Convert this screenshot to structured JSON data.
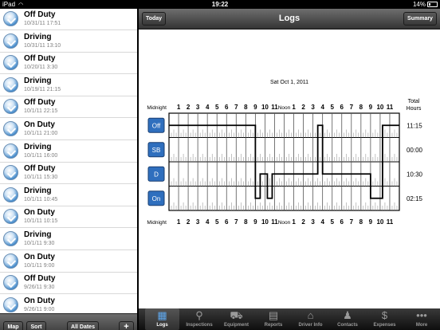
{
  "status_bar": {
    "carrier": "iPad",
    "time": "19:22",
    "battery": "14%"
  },
  "entries": [
    {
      "status": "Off Duty",
      "time": "10/31/11 17:51"
    },
    {
      "status": "Driving",
      "time": "10/31/11 13:10"
    },
    {
      "status": "Off Duty",
      "time": "10/20/11 3:30"
    },
    {
      "status": "Driving",
      "time": "10/19/11 21:15"
    },
    {
      "status": "Off Duty",
      "time": "10/1/11 22:15"
    },
    {
      "status": "On Duty",
      "time": "10/1/11 21:00"
    },
    {
      "status": "Driving",
      "time": "10/1/11 16:00"
    },
    {
      "status": "Off Duty",
      "time": "10/1/11 15:30"
    },
    {
      "status": "Driving",
      "time": "10/1/11 10:45"
    },
    {
      "status": "On Duty",
      "time": "10/1/11 10:15"
    },
    {
      "status": "Driving",
      "time": "10/1/11 9:30"
    },
    {
      "status": "On Duty",
      "time": "10/1/11 9:00"
    },
    {
      "status": "Off Duty",
      "time": "9/26/11 9:30"
    },
    {
      "status": "On Duty",
      "time": "9/26/11 9:00"
    }
  ],
  "left_toolbar": {
    "map": "Map",
    "sort": "Sort",
    "all_dates": "All Dates",
    "add": "+"
  },
  "nav": {
    "today": "Today",
    "title": "Logs",
    "summary": "Summary"
  },
  "log": {
    "date": "Sat Oct 1, 2011",
    "top_labels": [
      "Midnight",
      "1",
      "2",
      "3",
      "4",
      "5",
      "6",
      "7",
      "8",
      "9",
      "10",
      "11",
      "Noon",
      "1",
      "2",
      "3",
      "4",
      "5",
      "6",
      "7",
      "8",
      "9",
      "10",
      "11"
    ],
    "bottom_labels": [
      "Midnight",
      "1",
      "2",
      "3",
      "4",
      "5",
      "6",
      "7",
      "8",
      "9",
      "10",
      "11",
      "Noon",
      "1",
      "2",
      "3",
      "4",
      "5",
      "6",
      "7",
      "8",
      "9",
      "10",
      "11"
    ],
    "total_header": "Total Hours",
    "rows": [
      {
        "label": "Off",
        "total": "11:15"
      },
      {
        "label": "SB",
        "total": "00:00"
      },
      {
        "label": "D",
        "total": "10:30"
      },
      {
        "label": "On",
        "total": "02:15"
      }
    ],
    "segments": [
      {
        "start": 0,
        "end": 9,
        "row": 0
      },
      {
        "start": 9,
        "end": 9.5,
        "row": 3
      },
      {
        "start": 9.5,
        "end": 10.25,
        "row": 2
      },
      {
        "start": 10.25,
        "end": 10.75,
        "row": 3
      },
      {
        "start": 10.75,
        "end": 15.5,
        "row": 2
      },
      {
        "start": 15.5,
        "end": 16,
        "row": 0
      },
      {
        "start": 16,
        "end": 21,
        "row": 2
      },
      {
        "start": 21,
        "end": 22.25,
        "row": 3
      },
      {
        "start": 22.25,
        "end": 24,
        "row": 0
      }
    ]
  },
  "tabs": [
    {
      "label": "Logs",
      "icon": "logs-icon",
      "glyph": "▦"
    },
    {
      "label": "Inspections",
      "icon": "magnifier-icon",
      "glyph": "⚲"
    },
    {
      "label": "Equipment",
      "icon": "truck-icon",
      "glyph": "⛟"
    },
    {
      "label": "Reports",
      "icon": "clipboard-icon",
      "glyph": "▤"
    },
    {
      "label": "Driver Info",
      "icon": "house-icon",
      "glyph": "⌂"
    },
    {
      "label": "Contacts",
      "icon": "person-icon",
      "glyph": "♟"
    },
    {
      "label": "Expenses",
      "icon": "dollar-icon",
      "glyph": "$"
    },
    {
      "label": "More",
      "icon": "more-icon",
      "glyph": "•••"
    }
  ],
  "colors": {
    "accent": "#2f6fbe",
    "selected_row": "#dce6f2"
  }
}
